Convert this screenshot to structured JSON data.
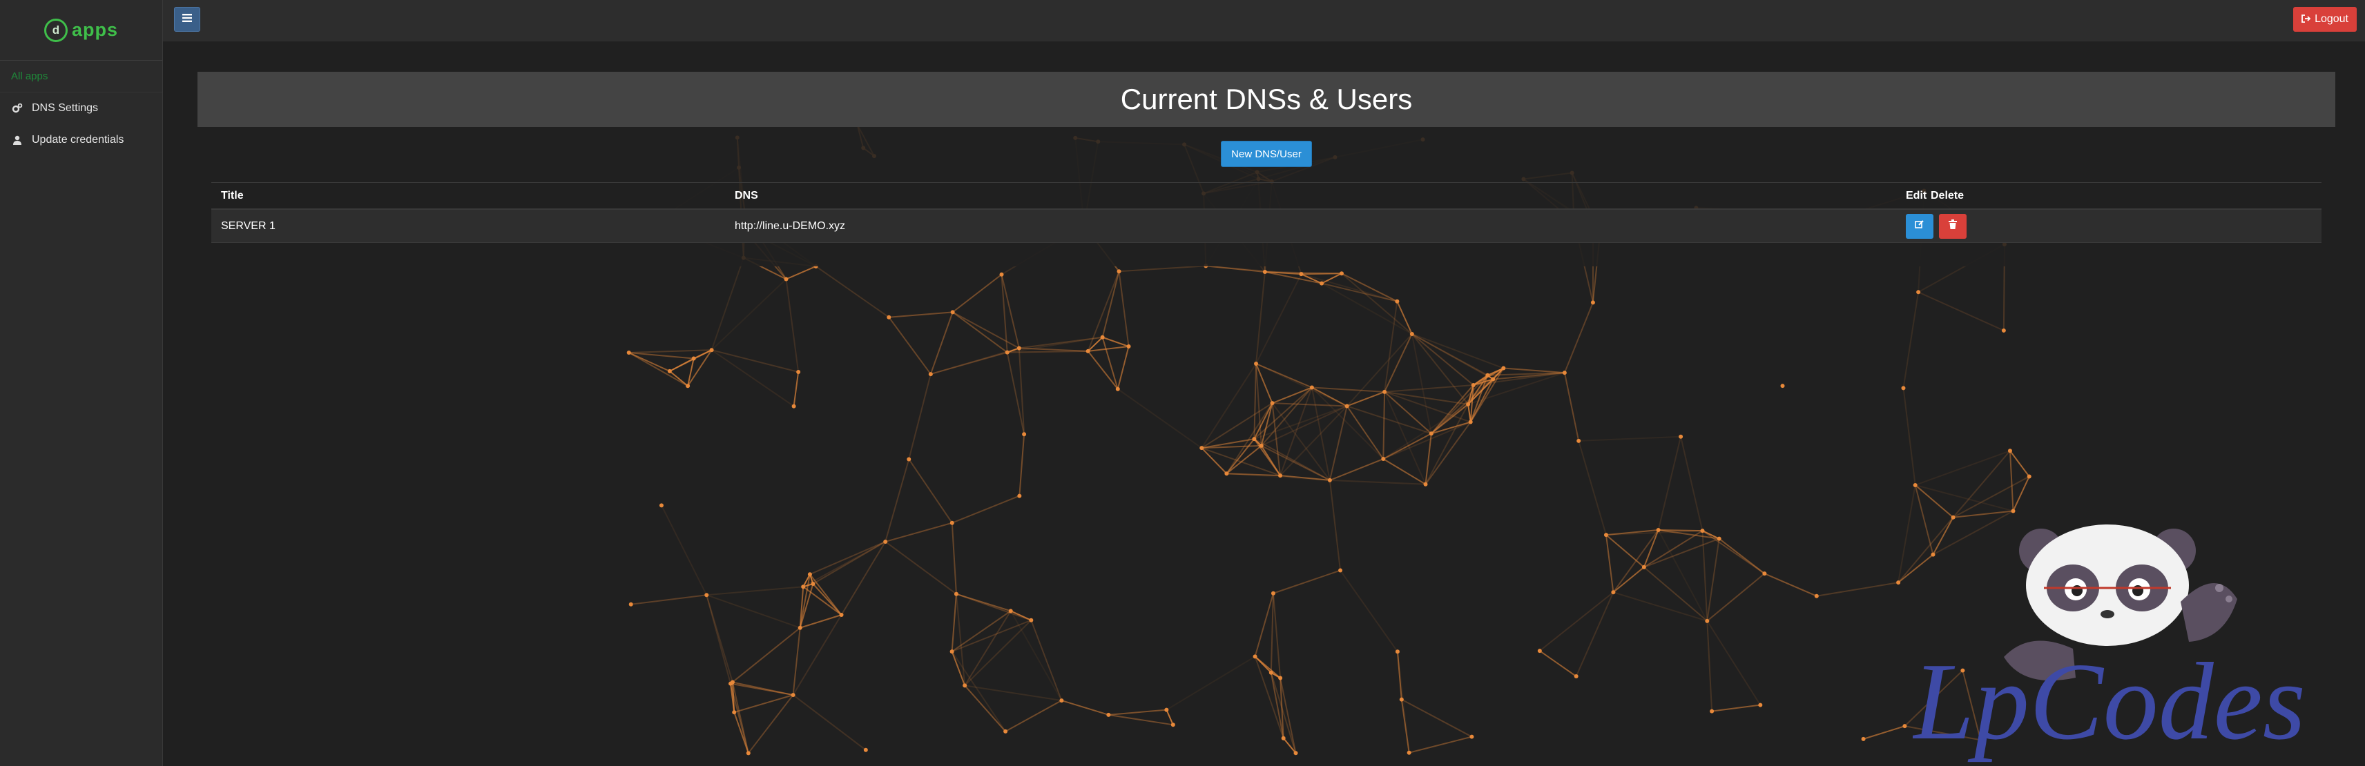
{
  "sidebar": {
    "logo_mark": "d",
    "logo_text": "apps",
    "menu_header": "All apps",
    "items": [
      {
        "label": "DNS Settings",
        "icon": "gears-icon"
      },
      {
        "label": "Update credentials",
        "icon": "user-icon"
      }
    ]
  },
  "topbar": {
    "toggle_icon": "bars-icon",
    "logout_label": "Logout"
  },
  "panel": {
    "title": "Current DNSs & Users",
    "new_button": "New DNS/User",
    "table": {
      "headers": {
        "title": "Title",
        "dns": "DNS",
        "edit": "Edit",
        "delete": "Delete"
      },
      "rows": [
        {
          "title": "SERVER 1",
          "dns": "http://line.u-DEMO.xyz"
        }
      ]
    }
  },
  "watermark": {
    "text": "LpCodes"
  },
  "colors": {
    "accent_green": "#3fbf4a",
    "primary_blue": "#2b8fd6",
    "danger_red": "#d9403a",
    "network_orange": "#e8893a"
  }
}
